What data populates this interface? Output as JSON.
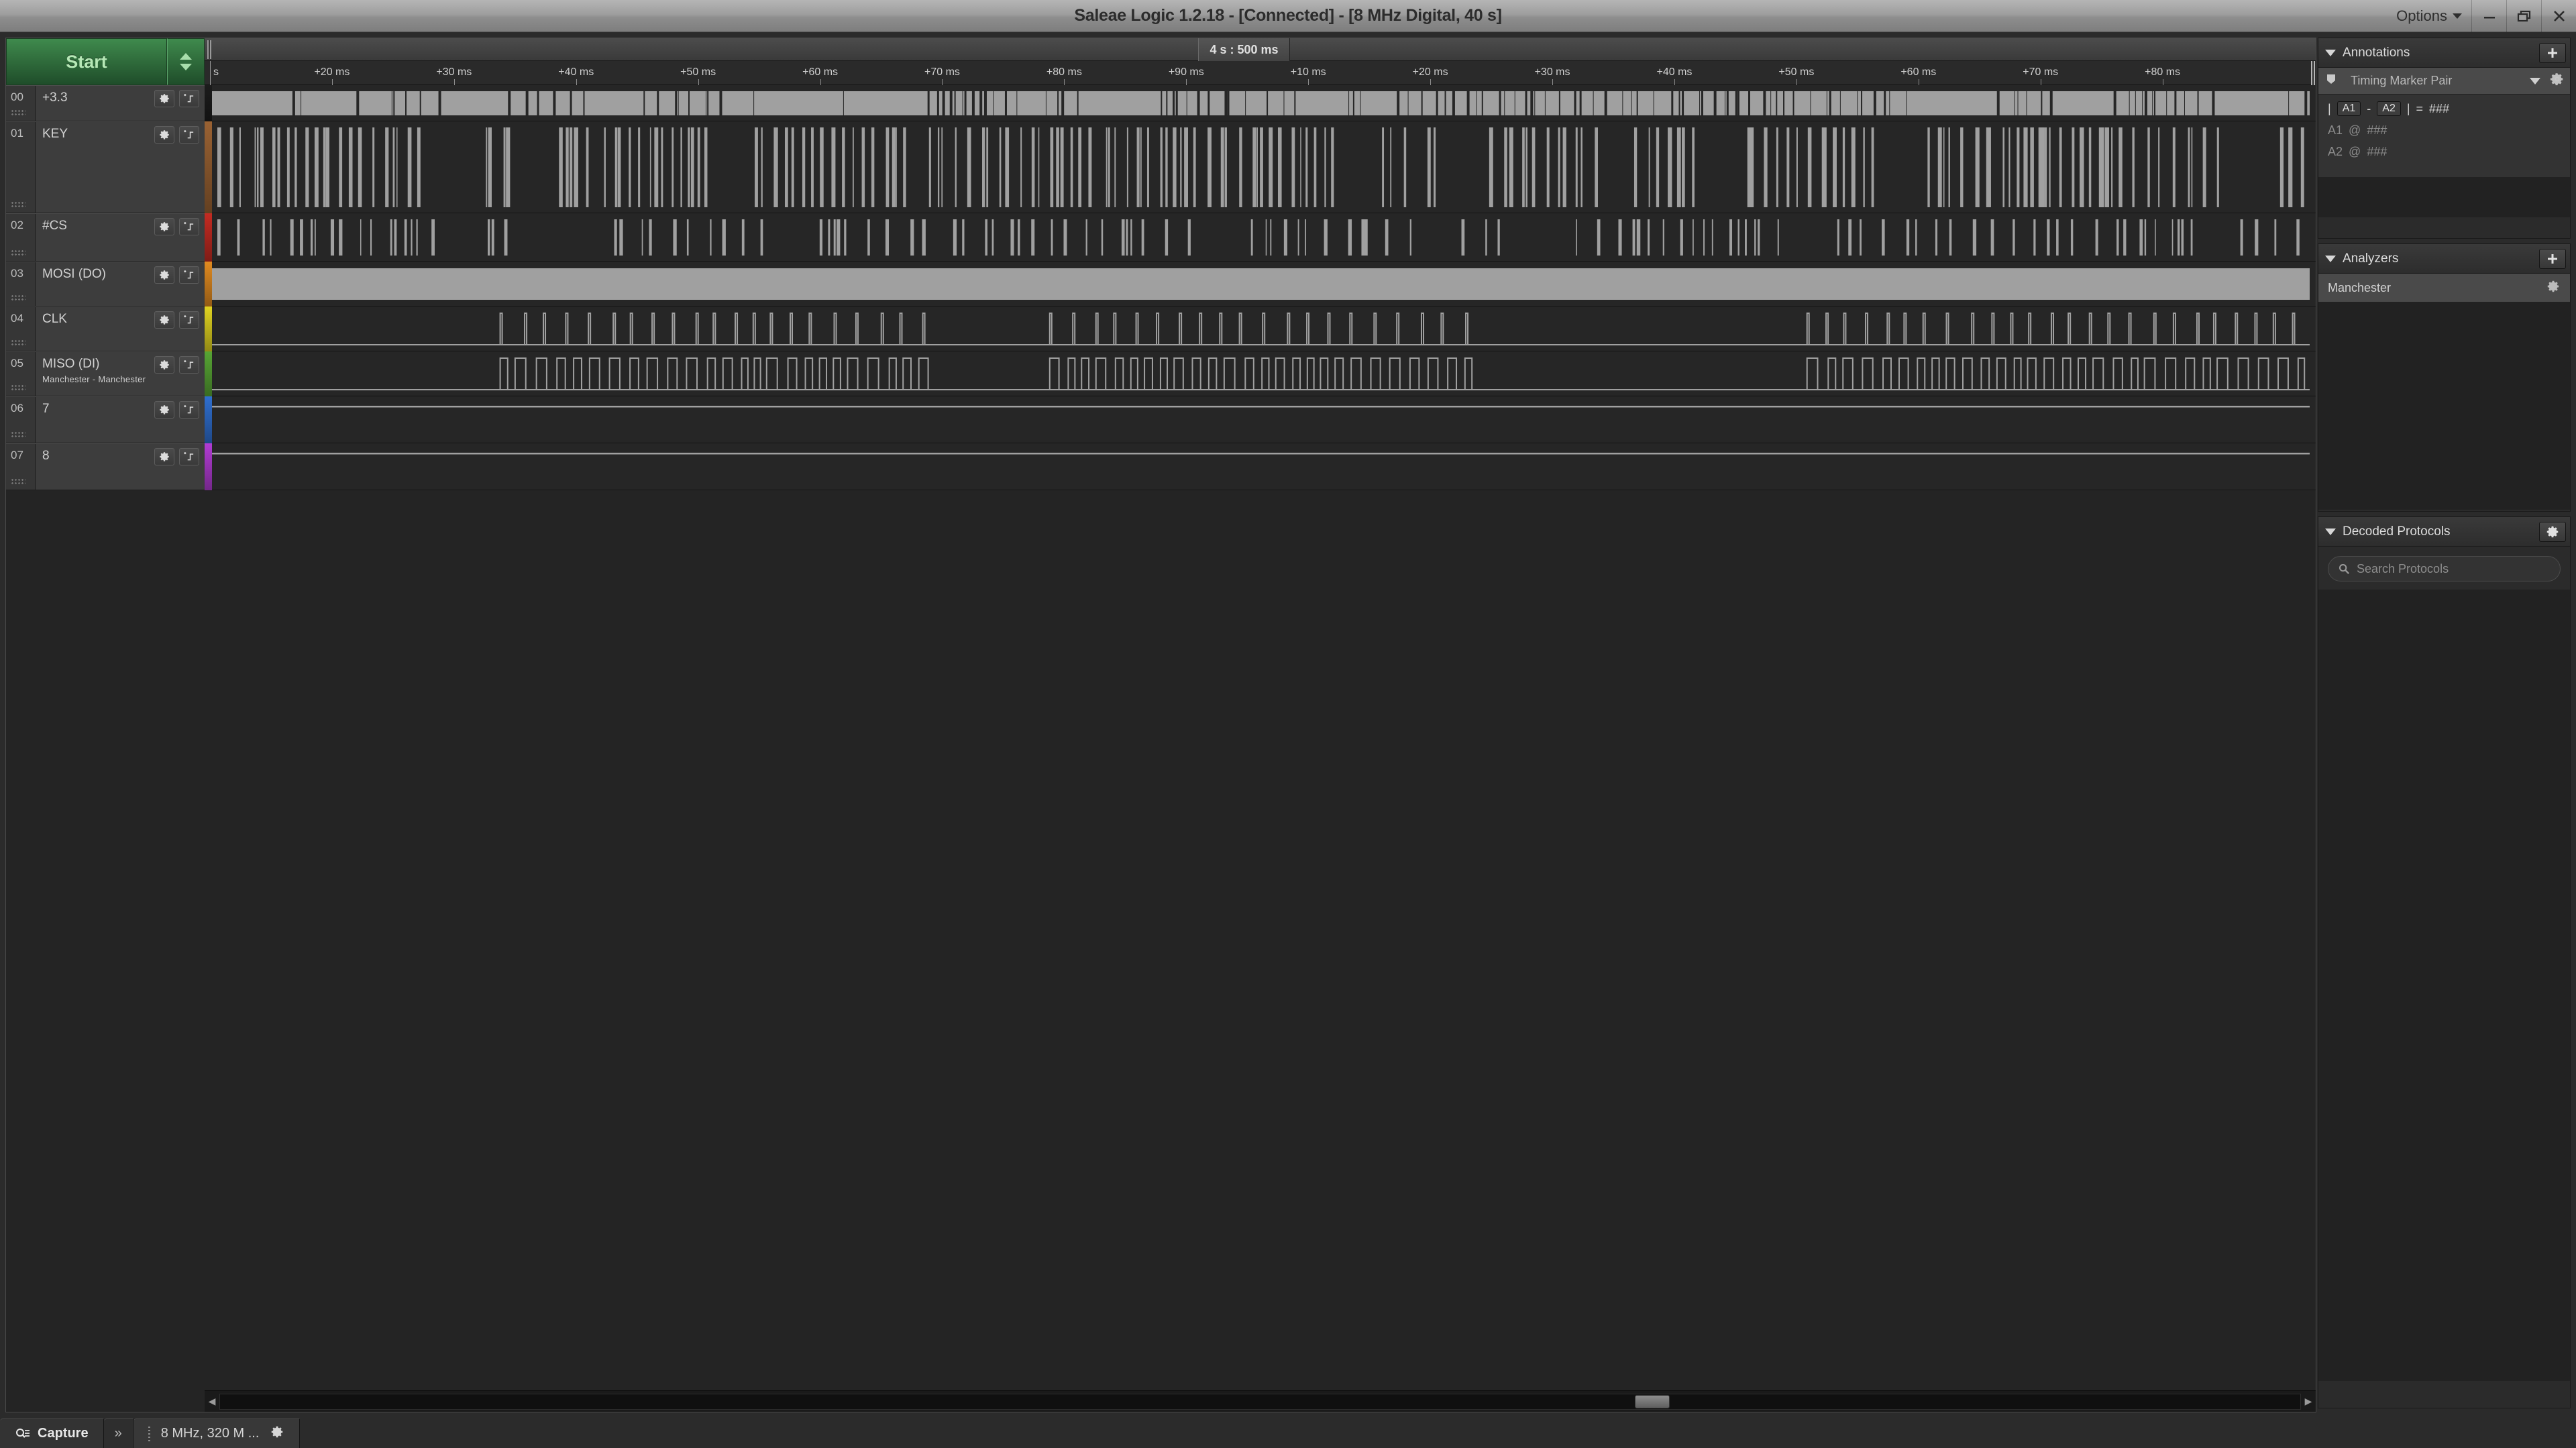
{
  "window": {
    "title": "Saleae Logic 1.2.18 - [Connected] - [8 MHz Digital, 40 s]",
    "options_label": "Options",
    "minimize_icon": "minimize-icon",
    "maximize_icon": "restore-icon",
    "close_icon": "close-icon"
  },
  "toolbar": {
    "start_label": "Start",
    "spin_up_icon": "triangle-up-icon",
    "spin_down_icon": "triangle-down-icon"
  },
  "channels": [
    {
      "num": "00",
      "name": "+3.3",
      "sub": "",
      "color": "#1c1c1c",
      "height": 54,
      "pattern": "dense-high",
      "seed": 11
    },
    {
      "num": "01",
      "name": "KEY",
      "sub": "",
      "color": "#9a6233",
      "height": 137,
      "pattern": "dense-low",
      "seed": 23
    },
    {
      "num": "02",
      "name": "#CS",
      "sub": "",
      "color": "#c42b22",
      "height": 72,
      "pattern": "sparse-low",
      "seed": 37
    },
    {
      "num": "03",
      "name": "MOSI (DO)",
      "sub": "",
      "color": "#e08a20",
      "height": 67,
      "pattern": "solid-high",
      "seed": 41
    },
    {
      "num": "04",
      "name": "CLK",
      "sub": "",
      "color": "#e0d321",
      "height": 67,
      "pattern": "clock",
      "seed": 53
    },
    {
      "num": "05",
      "name": "MISO (DI)",
      "sub": "Manchester - Manchester",
      "color": "#57a534",
      "height": 67,
      "pattern": "manchester",
      "seed": 59
    },
    {
      "num": "06",
      "name": "7",
      "sub": "",
      "color": "#2f6fd0",
      "height": 70,
      "pattern": "flat-low",
      "seed": 67
    },
    {
      "num": "07",
      "name": "8",
      "sub": "",
      "color": "#b23cd4",
      "height": 70,
      "pattern": "flat-low",
      "seed": 71
    }
  ],
  "channel_icons": {
    "settings": "gear-icon",
    "trigger": "add-trigger-edge-icon"
  },
  "timeline": {
    "center_label": "4 s : 500 ms",
    "origin_label": "s",
    "ticks": [
      "+20 ms",
      "+30 ms",
      "+40 ms",
      "+50 ms",
      "+60 ms",
      "+70 ms",
      "+80 ms",
      "+90 ms",
      "+10 ms",
      "+20 ms",
      "+30 ms",
      "+40 ms",
      "+50 ms",
      "+60 ms",
      "+70 ms",
      "+80 ms"
    ]
  },
  "scrollbar": {
    "left_arrow": "chevron-left-icon",
    "right_arrow": "chevron-right-icon",
    "thumb_position_pct": 68
  },
  "sidebar": {
    "annotations": {
      "title": "Annotations",
      "add_icon": "plus-icon",
      "collapse_icon": "triangle-down-icon",
      "marker": {
        "flag_icon": "flag-icon",
        "name": "Timing Marker Pair",
        "dropdown_icon": "triangle-down-icon",
        "gear_icon": "gear-icon"
      },
      "measurement": {
        "prefix": "|",
        "a1": "A1",
        "dash": "-",
        "a2": "A2",
        "suffix": "|",
        "equals": "=",
        "value": "###"
      },
      "rows": [
        {
          "label": "A1",
          "at": "@",
          "value": "###"
        },
        {
          "label": "A2",
          "at": "@",
          "value": "###"
        }
      ]
    },
    "analyzers": {
      "title": "Analyzers",
      "add_icon": "plus-icon",
      "collapse_icon": "triangle-down-icon",
      "items": [
        {
          "name": "Manchester",
          "gear_icon": "gear-icon"
        }
      ]
    },
    "decoded_protocols": {
      "title": "Decoded Protocols",
      "gear_icon": "gear-icon",
      "collapse_icon": "triangle-down-icon",
      "search_placeholder": "Search Protocols",
      "search_icon": "search-icon",
      "search_value": ""
    }
  },
  "statusbar": {
    "capture_label": "Capture",
    "capture_icon": "capture-search-icon",
    "expand_icon": "double-chevron-right-icon",
    "device_label": "8 MHz, 320 M ...",
    "device_gear_icon": "gear-icon"
  },
  "colors": {
    "accent_green": "#2f6b3b",
    "panel_bg": "#2b2b2b",
    "wave_high": "#a0a0a0",
    "wave_bg": "#262626"
  }
}
